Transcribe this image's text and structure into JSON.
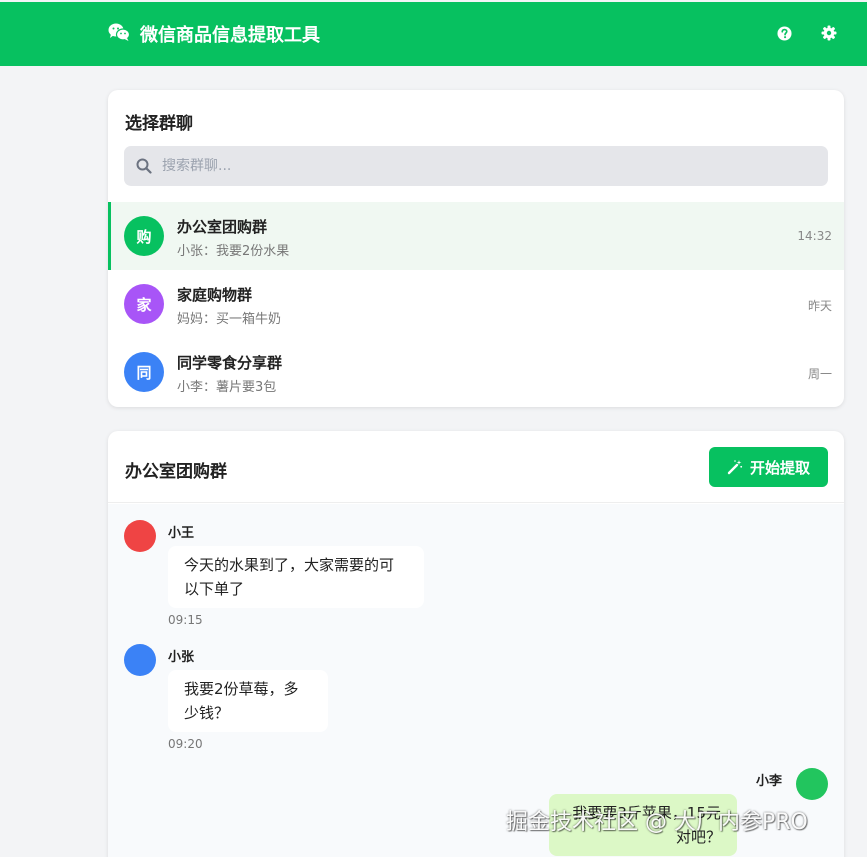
{
  "header": {
    "title": "微信商品信息提取工具",
    "icons": {
      "brand": "wechat-icon",
      "help": "help-icon",
      "settings": "gear-icon"
    }
  },
  "colors": {
    "brand": "#07c160",
    "self_bubble": "#dcf8c6",
    "active_row": "#f0f8f2"
  },
  "group_panel": {
    "title": "选择群聊",
    "search": {
      "placeholder": "搜索群聊...",
      "value": ""
    },
    "groups": [
      {
        "avatar": "购",
        "name": "办公室团购群",
        "last_message": "小张：我要2份水果",
        "time": "14:32",
        "color": "#07c160",
        "active": true
      },
      {
        "avatar": "家",
        "name": "家庭购物群",
        "last_message": "妈妈：买一箱牛奶",
        "time": "昨天",
        "color": "#a855f7",
        "active": false
      },
      {
        "avatar": "同",
        "name": "同学零食分享群",
        "last_message": "小李：薯片要3包",
        "time": "周一",
        "color": "#3b82f6",
        "active": false
      }
    ]
  },
  "chat_panel": {
    "title": "办公室团购群",
    "extract_button": "开始提取",
    "messages": [
      {
        "sender": "小王",
        "text": "今天的水果到了，大家需要的可以下单了",
        "time": "09:15",
        "color": "#ef4444",
        "self": false
      },
      {
        "sender": "小张",
        "text": "我要2份草莓，多少钱？",
        "time": "09:20",
        "color": "#3b82f6",
        "self": false
      },
      {
        "sender": "小李",
        "text": "我要要3斤苹果，15元对吧？",
        "time": "",
        "color": "#22c55e",
        "self": true
      }
    ]
  },
  "watermark": "掘金技术社区 @ 大厂内参PRO"
}
